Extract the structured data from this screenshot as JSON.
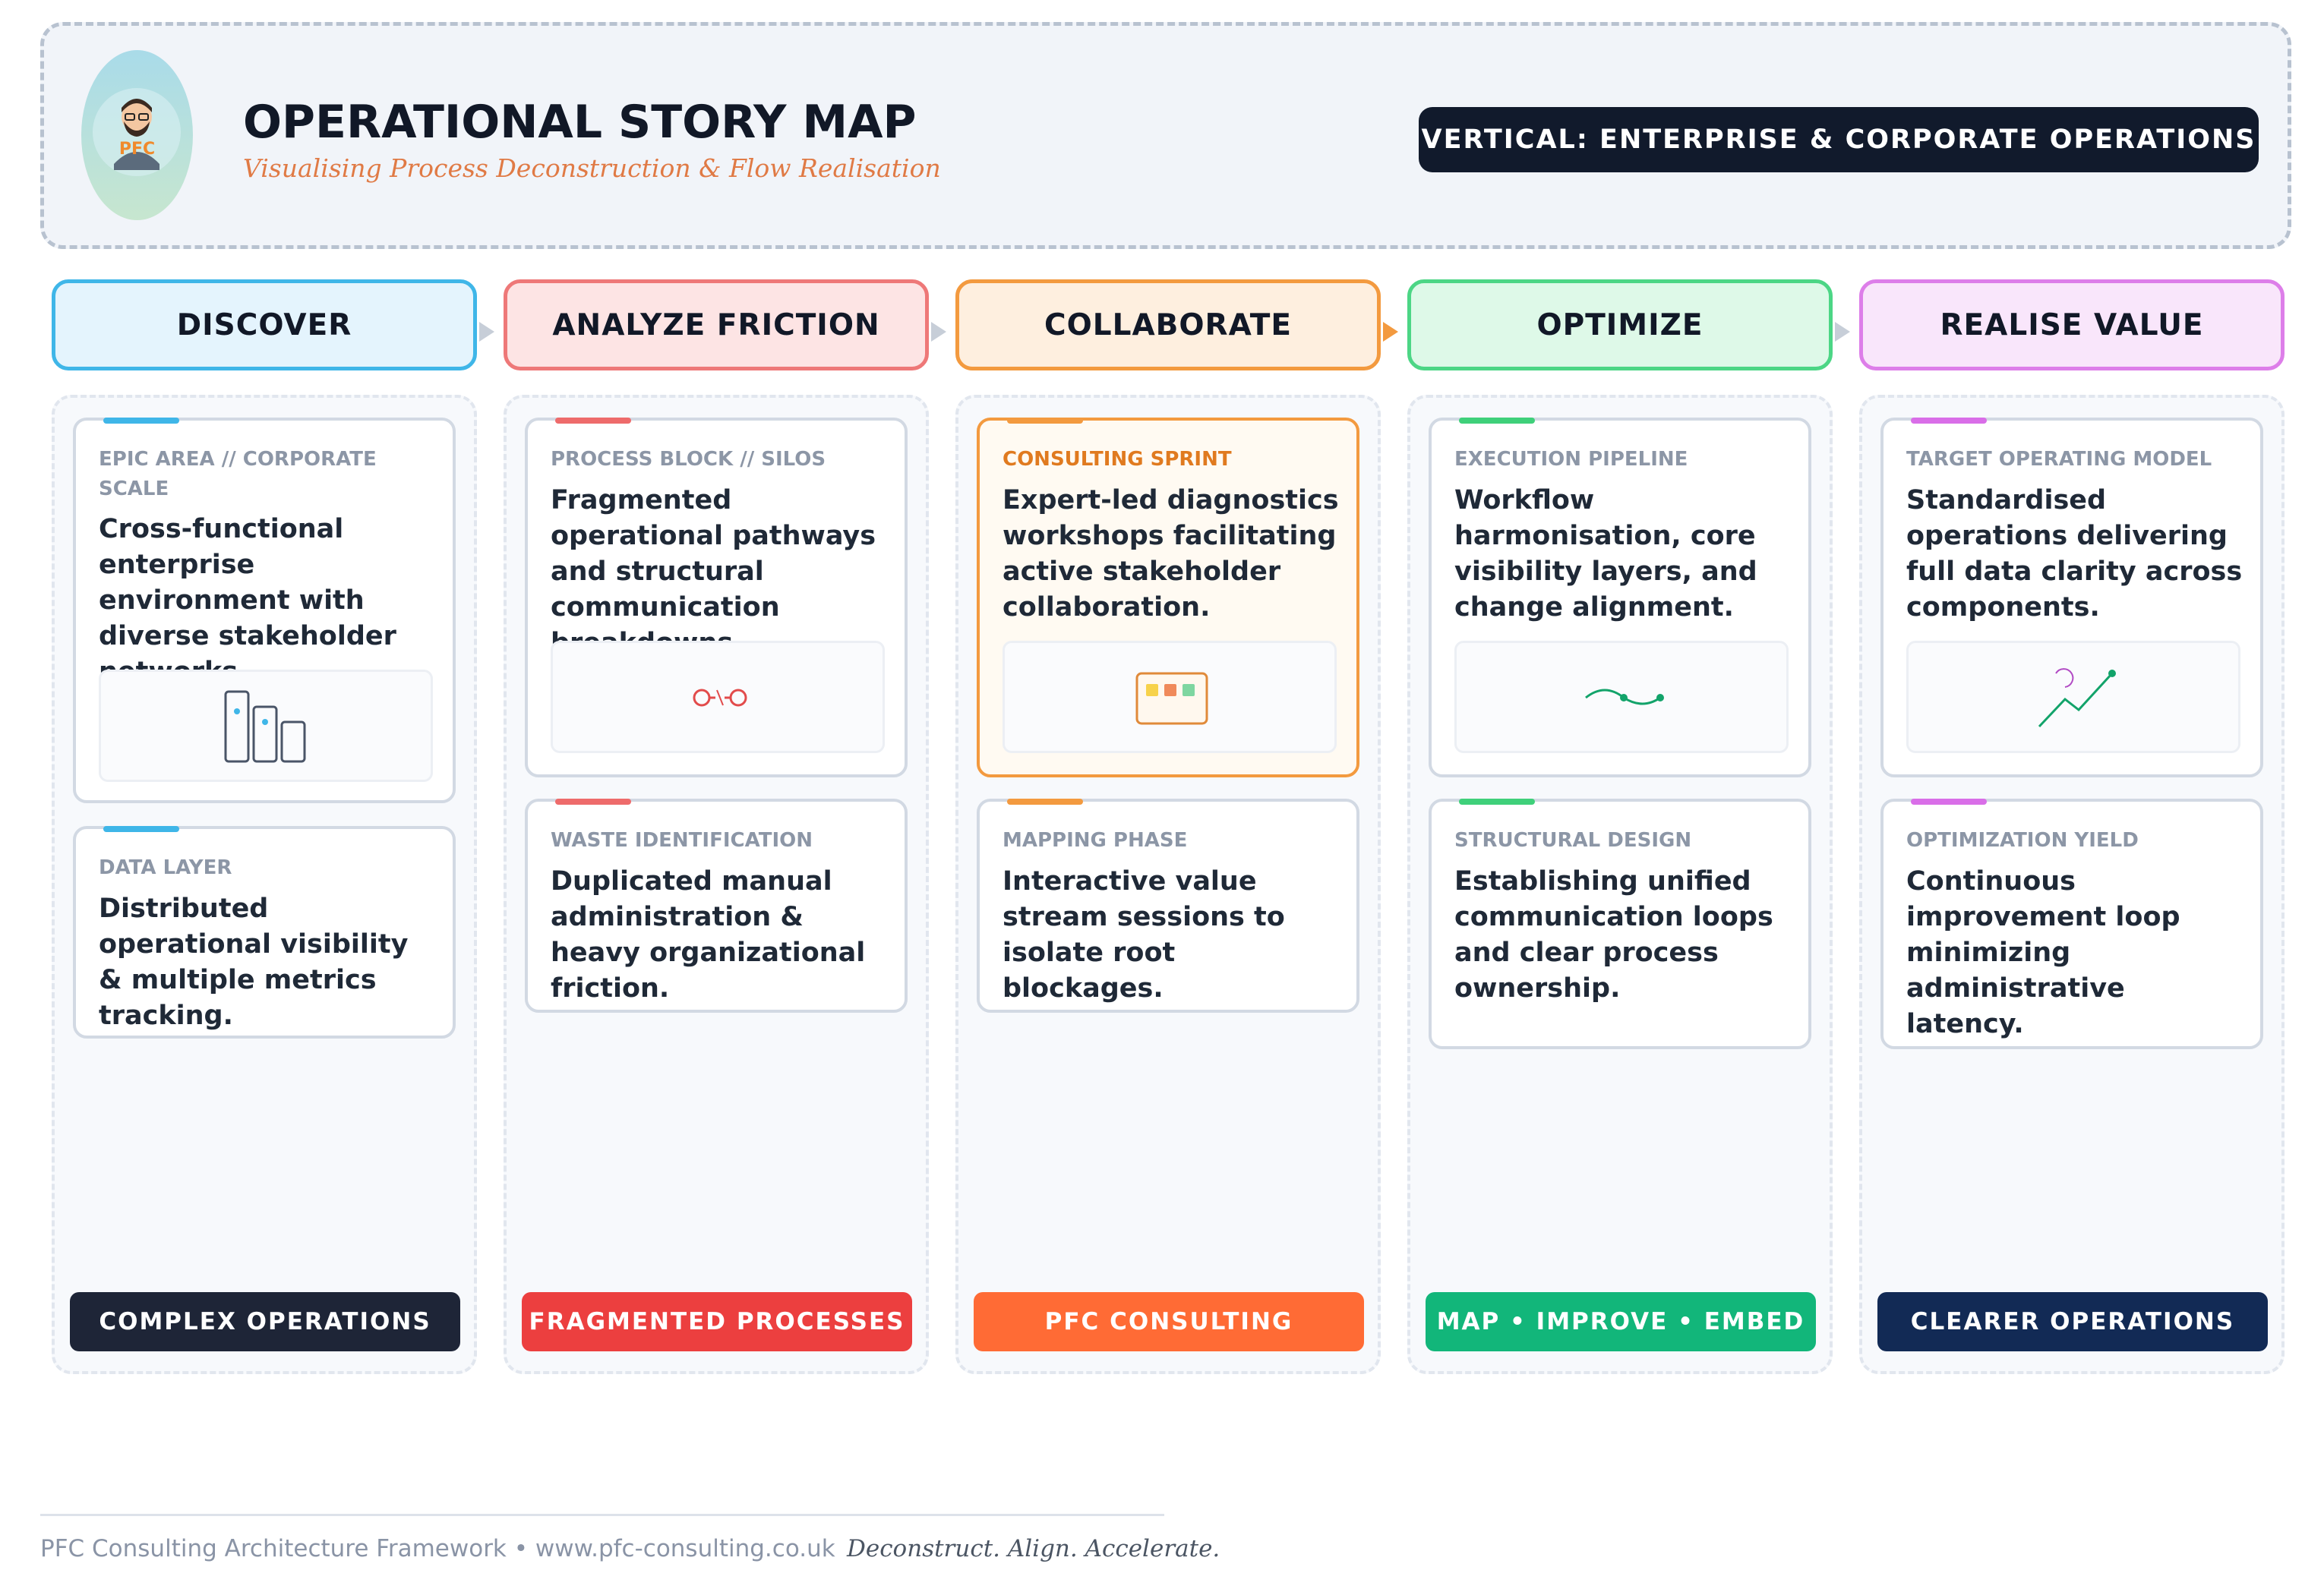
{
  "header": {
    "logo_text": "PFC",
    "title": "OPERATIONAL STORY MAP",
    "subtitle": "Visualising Process Deconstruction & Flow Realisation",
    "vertical_badge": "VERTICAL: ENTERPRISE & CORPORATE OPERATIONS"
  },
  "stages": [
    {
      "title": "DISCOVER",
      "colors": {
        "accent": "#3fb6e8",
        "header_bg": "#e4f4fd",
        "border": "#3fb6e8",
        "pill": "#1e2537"
      },
      "cards": [
        {
          "label": "EPIC AREA // CORPORATE SCALE",
          "text": "Cross-functional enterprise environment with diverse stakeholder networks.",
          "icon": "bars-icon"
        },
        {
          "label": "DATA LAYER",
          "text": "Distributed operational visibility & multiple metrics tracking."
        }
      ],
      "footer": "COMPLEX OPERATIONS"
    },
    {
      "title": "ANALYZE FRICTION",
      "colors": {
        "accent": "#ee6b6b",
        "header_bg": "#fde4e4",
        "border": "#ee7878",
        "pill": "#ec3f3f"
      },
      "cards": [
        {
          "label": "PROCESS BLOCK // SILOS",
          "text": "Fragmented operational pathways and structural communication breakdowns.",
          "icon": "broken-link-icon"
        },
        {
          "label": "WASTE IDENTIFICATION",
          "text": "Duplicated manual administration & heavy organizational friction."
        }
      ],
      "footer": "FRAGMENTED PROCESSES"
    },
    {
      "title": "COLLABORATE",
      "colors": {
        "accent": "#f39a3f",
        "header_bg": "#feefdf",
        "border": "#f39a3f",
        "pill": "#ff6b35"
      },
      "cards": [
        {
          "label": "CONSULTING SPRINT",
          "text": "Expert-led diagnostics workshops facilitating active stakeholder collaboration.",
          "icon": "workshop-board-icon"
        },
        {
          "label": "MAPPING PHASE",
          "text": "Interactive value stream sessions to isolate root blockages."
        }
      ],
      "footer": "PFC CONSULTING"
    },
    {
      "title": "OPTIMIZE",
      "colors": {
        "accent": "#3fd07a",
        "header_bg": "#def9e8",
        "border": "#4cd685",
        "pill": "#12b67a"
      },
      "cards": [
        {
          "label": "EXECUTION PIPELINE",
          "text": "Workflow harmonisation, core visibility layers, and change alignment.",
          "icon": "flow-curve-icon"
        },
        {
          "label": "STRUCTURAL DESIGN",
          "text": "Establishing unified communication loops and clear process ownership."
        }
      ],
      "footer": "MAP • IMPROVE • EMBED"
    },
    {
      "title": "REALISE VALUE",
      "colors": {
        "accent": "#d96ee8",
        "header_bg": "#f9e6fb",
        "border": "#dd7ee9",
        "pill": "#122a55"
      },
      "cards": [
        {
          "label": "TARGET OPERATING MODEL",
          "text": "Standardised operations delivering full data clarity across components.",
          "icon": "trend-up-icon"
        },
        {
          "label": "OPTIMIZATION YIELD",
          "text": "Continuous improvement loop minimizing administrative latency."
        }
      ],
      "footer": "CLEARER OPERATIONS"
    }
  ],
  "footer": {
    "left": "PFC Consulting Architecture Framework • www.pfc-consulting.co.uk",
    "right": "Deconstruct. Align. Accelerate."
  }
}
